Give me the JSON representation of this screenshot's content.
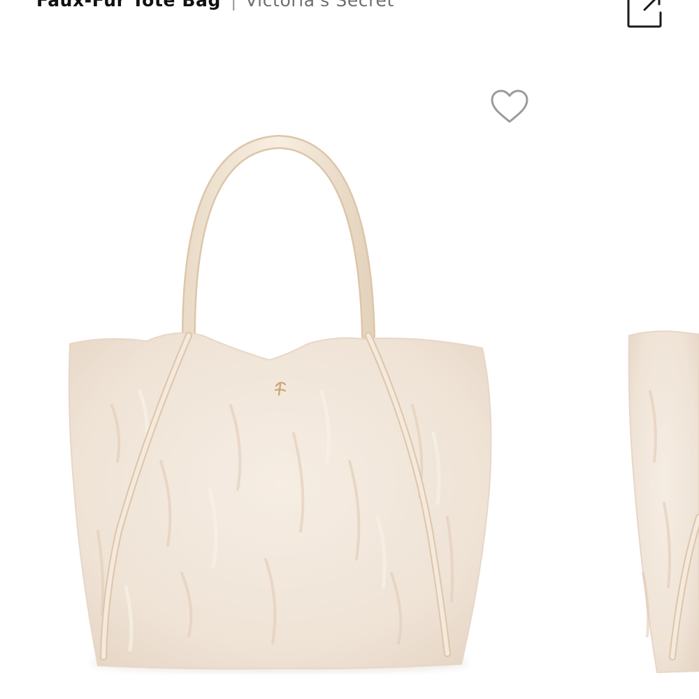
{
  "header": {
    "product_name": "Faux-Fur Tote Bag",
    "separator": "|",
    "brand": "Victoria's Secret",
    "share_icon": "share-icon"
  },
  "product": {
    "favorite_icon": "heart-outline-icon",
    "image_subject": "cream faux-fur tote bag",
    "colors": {
      "fur": "#f1e6da",
      "fur_shadow": "#e3cfbd",
      "handle": "#f3e7d7",
      "handle_edge": "#ddc8ae",
      "heart_stroke": "#9b9b9b"
    }
  }
}
